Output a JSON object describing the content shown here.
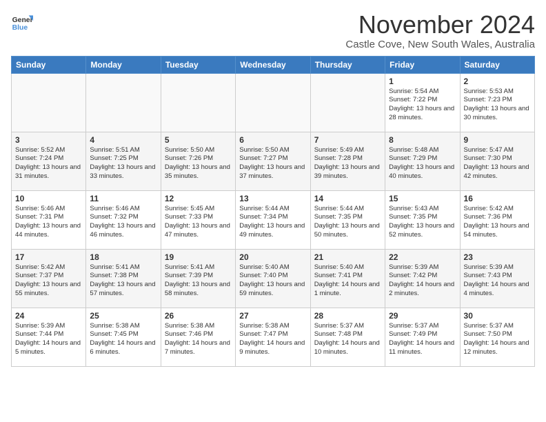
{
  "header": {
    "logo_general": "General",
    "logo_blue": "Blue",
    "title": "November 2024",
    "subtitle": "Castle Cove, New South Wales, Australia"
  },
  "calendar": {
    "days_of_week": [
      "Sunday",
      "Monday",
      "Tuesday",
      "Wednesday",
      "Thursday",
      "Friday",
      "Saturday"
    ],
    "weeks": [
      [
        {
          "day": "",
          "info": ""
        },
        {
          "day": "",
          "info": ""
        },
        {
          "day": "",
          "info": ""
        },
        {
          "day": "",
          "info": ""
        },
        {
          "day": "",
          "info": ""
        },
        {
          "day": "1",
          "info": "Sunrise: 5:54 AM\nSunset: 7:22 PM\nDaylight: 13 hours and 28 minutes."
        },
        {
          "day": "2",
          "info": "Sunrise: 5:53 AM\nSunset: 7:23 PM\nDaylight: 13 hours and 30 minutes."
        }
      ],
      [
        {
          "day": "3",
          "info": "Sunrise: 5:52 AM\nSunset: 7:24 PM\nDaylight: 13 hours and 31 minutes."
        },
        {
          "day": "4",
          "info": "Sunrise: 5:51 AM\nSunset: 7:25 PM\nDaylight: 13 hours and 33 minutes."
        },
        {
          "day": "5",
          "info": "Sunrise: 5:50 AM\nSunset: 7:26 PM\nDaylight: 13 hours and 35 minutes."
        },
        {
          "day": "6",
          "info": "Sunrise: 5:50 AM\nSunset: 7:27 PM\nDaylight: 13 hours and 37 minutes."
        },
        {
          "day": "7",
          "info": "Sunrise: 5:49 AM\nSunset: 7:28 PM\nDaylight: 13 hours and 39 minutes."
        },
        {
          "day": "8",
          "info": "Sunrise: 5:48 AM\nSunset: 7:29 PM\nDaylight: 13 hours and 40 minutes."
        },
        {
          "day": "9",
          "info": "Sunrise: 5:47 AM\nSunset: 7:30 PM\nDaylight: 13 hours and 42 minutes."
        }
      ],
      [
        {
          "day": "10",
          "info": "Sunrise: 5:46 AM\nSunset: 7:31 PM\nDaylight: 13 hours and 44 minutes."
        },
        {
          "day": "11",
          "info": "Sunrise: 5:46 AM\nSunset: 7:32 PM\nDaylight: 13 hours and 46 minutes."
        },
        {
          "day": "12",
          "info": "Sunrise: 5:45 AM\nSunset: 7:33 PM\nDaylight: 13 hours and 47 minutes."
        },
        {
          "day": "13",
          "info": "Sunrise: 5:44 AM\nSunset: 7:34 PM\nDaylight: 13 hours and 49 minutes."
        },
        {
          "day": "14",
          "info": "Sunrise: 5:44 AM\nSunset: 7:35 PM\nDaylight: 13 hours and 50 minutes."
        },
        {
          "day": "15",
          "info": "Sunrise: 5:43 AM\nSunset: 7:35 PM\nDaylight: 13 hours and 52 minutes."
        },
        {
          "day": "16",
          "info": "Sunrise: 5:42 AM\nSunset: 7:36 PM\nDaylight: 13 hours and 54 minutes."
        }
      ],
      [
        {
          "day": "17",
          "info": "Sunrise: 5:42 AM\nSunset: 7:37 PM\nDaylight: 13 hours and 55 minutes."
        },
        {
          "day": "18",
          "info": "Sunrise: 5:41 AM\nSunset: 7:38 PM\nDaylight: 13 hours and 57 minutes."
        },
        {
          "day": "19",
          "info": "Sunrise: 5:41 AM\nSunset: 7:39 PM\nDaylight: 13 hours and 58 minutes."
        },
        {
          "day": "20",
          "info": "Sunrise: 5:40 AM\nSunset: 7:40 PM\nDaylight: 13 hours and 59 minutes."
        },
        {
          "day": "21",
          "info": "Sunrise: 5:40 AM\nSunset: 7:41 PM\nDaylight: 14 hours and 1 minute."
        },
        {
          "day": "22",
          "info": "Sunrise: 5:39 AM\nSunset: 7:42 PM\nDaylight: 14 hours and 2 minutes."
        },
        {
          "day": "23",
          "info": "Sunrise: 5:39 AM\nSunset: 7:43 PM\nDaylight: 14 hours and 4 minutes."
        }
      ],
      [
        {
          "day": "24",
          "info": "Sunrise: 5:39 AM\nSunset: 7:44 PM\nDaylight: 14 hours and 5 minutes."
        },
        {
          "day": "25",
          "info": "Sunrise: 5:38 AM\nSunset: 7:45 PM\nDaylight: 14 hours and 6 minutes."
        },
        {
          "day": "26",
          "info": "Sunrise: 5:38 AM\nSunset: 7:46 PM\nDaylight: 14 hours and 7 minutes."
        },
        {
          "day": "27",
          "info": "Sunrise: 5:38 AM\nSunset: 7:47 PM\nDaylight: 14 hours and 9 minutes."
        },
        {
          "day": "28",
          "info": "Sunrise: 5:37 AM\nSunset: 7:48 PM\nDaylight: 14 hours and 10 minutes."
        },
        {
          "day": "29",
          "info": "Sunrise: 5:37 AM\nSunset: 7:49 PM\nDaylight: 14 hours and 11 minutes."
        },
        {
          "day": "30",
          "info": "Sunrise: 5:37 AM\nSunset: 7:50 PM\nDaylight: 14 hours and 12 minutes."
        }
      ]
    ]
  }
}
